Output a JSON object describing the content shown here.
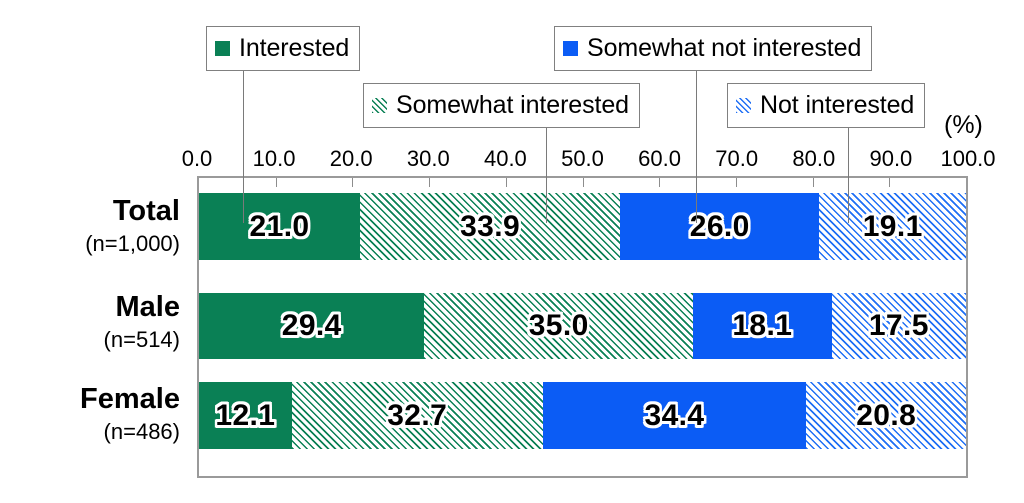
{
  "chart_data": {
    "type": "bar",
    "subtype": "horizontal-stacked-100",
    "title": "",
    "subtitle": "",
    "xlabel": "",
    "ylabel": "",
    "units_label": "(%)",
    "xlim": [
      0,
      100
    ],
    "xticks": [
      "0.0",
      "10.0",
      "20.0",
      "30.0",
      "40.0",
      "50.0",
      "60.0",
      "70.0",
      "80.0",
      "90.0",
      "100.0"
    ],
    "xtick_values": [
      0,
      10,
      20,
      30,
      40,
      50,
      60,
      70,
      80,
      90,
      100
    ],
    "grid": false,
    "legend_position": "top",
    "categories": [
      "Total",
      "Male",
      "Female"
    ],
    "category_sublabels": [
      "(n=1,000)",
      "(n=514)",
      "(n=486)"
    ],
    "series": [
      {
        "name": "Interested",
        "color": "#0a8055",
        "fill": "solid",
        "values": [
          21.0,
          29.4,
          12.1
        ],
        "labels": [
          "21.0",
          "29.4",
          "12.1"
        ]
      },
      {
        "name": "Somewhat interested",
        "color": "#0a8055",
        "fill": "hatch",
        "values": [
          33.9,
          35.0,
          32.7
        ],
        "labels": [
          "33.9",
          "35.0",
          "32.7"
        ]
      },
      {
        "name": "Somewhat not interested",
        "color": "#0b5cf5",
        "fill": "solid",
        "values": [
          26.0,
          18.1,
          34.4
        ],
        "labels": [
          "26.0",
          "18.1",
          "34.4"
        ]
      },
      {
        "name": "Not interested",
        "color": "#1f6ff5",
        "fill": "hatch",
        "values": [
          19.1,
          17.5,
          20.8
        ],
        "labels": [
          "19.1",
          "17.5",
          "20.8"
        ]
      }
    ]
  },
  "legend": {
    "items": [
      {
        "label": "Interested",
        "swatch": "solid-green-square-icon"
      },
      {
        "label": "Somewhat interested",
        "swatch": "hatch-green-square-icon"
      },
      {
        "label": "Somewhat not interested",
        "swatch": "solid-blue-square-icon"
      },
      {
        "label": "Not interested",
        "swatch": "hatch-blue-square-icon"
      }
    ]
  },
  "axis": {
    "units": "(%)"
  }
}
